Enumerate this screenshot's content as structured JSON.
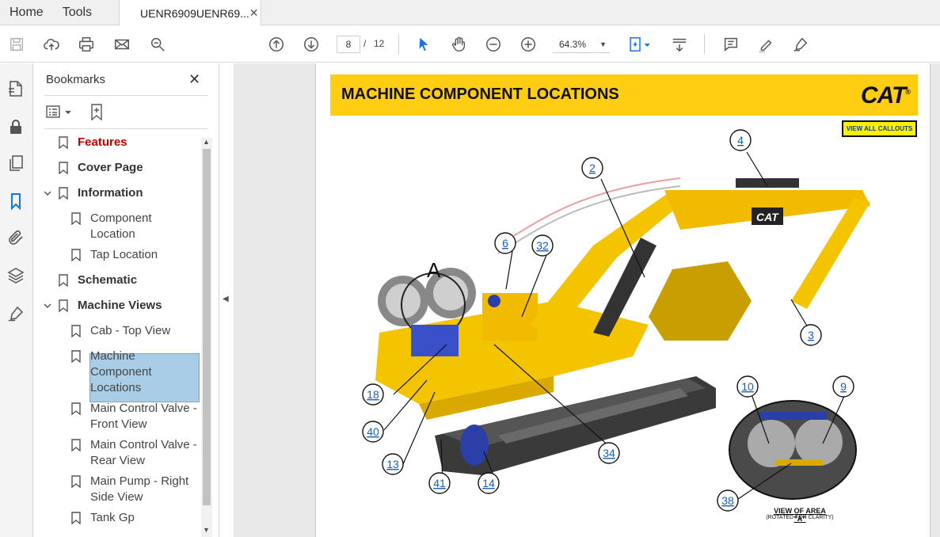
{
  "tabs": {
    "home": "Home",
    "tools": "Tools",
    "document": "UENR6909UENR69...",
    "close_glyph": "✕"
  },
  "toolbar": {
    "current_page": "8",
    "page_separator": "/",
    "total_pages": "12",
    "zoom": "64.3%"
  },
  "bookmarks": {
    "title": "Bookmarks",
    "close_glyph": "✕",
    "items": [
      {
        "label": "Features"
      },
      {
        "label": "Cover Page"
      },
      {
        "label": "Information"
      },
      {
        "label": "Component",
        "label2": "Location"
      },
      {
        "label": "Tap Location"
      },
      {
        "label": "Schematic"
      },
      {
        "label": "Machine Views"
      },
      {
        "label": "Cab - Top View"
      },
      {
        "label": "Machine",
        "label2": "Component",
        "label3": "Locations"
      },
      {
        "label": "Main Control Valve -",
        "label2": "Front View"
      },
      {
        "label": "Main Control Valve -",
        "label2": "Rear View"
      },
      {
        "label": "Main Pump - Right",
        "label2": "Side View"
      },
      {
        "label": "Tank Gp"
      }
    ]
  },
  "document": {
    "heading": "MACHINE COMPONENT LOCATIONS",
    "brand": "CAT",
    "view_all_button": "VIEW ALL CALLOUTS",
    "area_letter": "A",
    "callouts": [
      "4",
      "2",
      "6",
      "32",
      "3",
      "18",
      "40",
      "13",
      "41",
      "14",
      "34",
      "10",
      "9",
      "38"
    ],
    "view_area_label": "VIEW OF AREA \"A\"",
    "view_area_sub": "(ROTATED FOR CLARITY)"
  },
  "colors": {
    "cat_yellow": "#ffcd11",
    "selected_bookmark": "#a9cde6",
    "accent_blue": "#1a5fb4",
    "feature_red": "#c00000"
  }
}
